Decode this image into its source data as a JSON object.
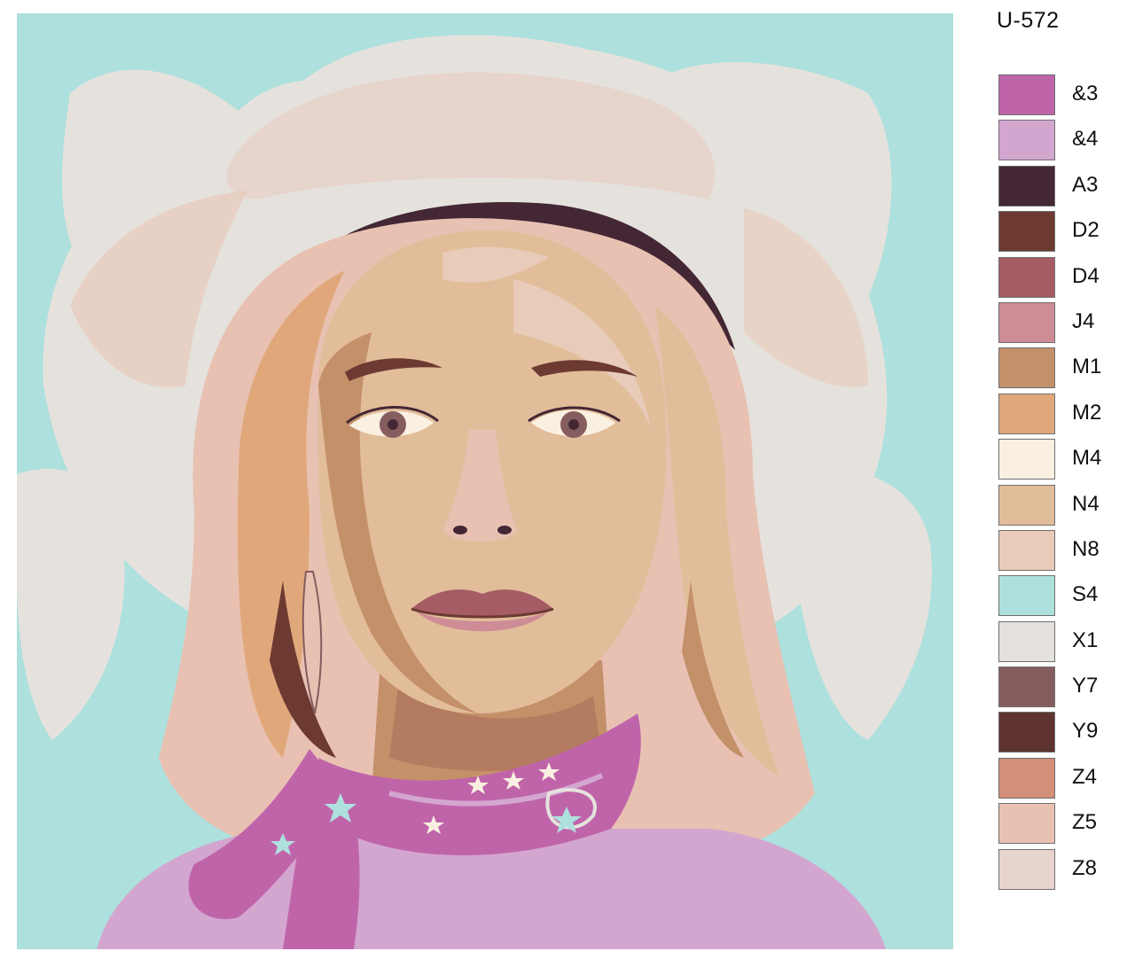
{
  "kit_code": "U-572",
  "palette": [
    {
      "code": "&3",
      "color": "#c064aa"
    },
    {
      "code": "&4",
      "color": "#d3a6cf"
    },
    {
      "code": "A3",
      "color": "#442734"
    },
    {
      "code": "D2",
      "color": "#6c3a31"
    },
    {
      "code": "D4",
      "color": "#a55c65"
    },
    {
      "code": "J4",
      "color": "#cd8c96"
    },
    {
      "code": "M1",
      "color": "#c4906a"
    },
    {
      "code": "M2",
      "color": "#e0a87a"
    },
    {
      "code": "M4",
      "color": "#faf0e1"
    },
    {
      "code": "N4",
      "color": "#e2bd9a"
    },
    {
      "code": "N8",
      "color": "#e8cbb9"
    },
    {
      "code": "S4",
      "color": "#aee0dd"
    },
    {
      "code": "X1",
      "color": "#e5e2dd"
    },
    {
      "code": "Y7",
      "color": "#865d5e"
    },
    {
      "code": "Y9",
      "color": "#5f3330"
    },
    {
      "code": "Z4",
      "color": "#d38f77"
    },
    {
      "code": "Z5",
      "color": "#e8c1b2"
    },
    {
      "code": "Z8",
      "color": "#e7d4cd"
    }
  ]
}
